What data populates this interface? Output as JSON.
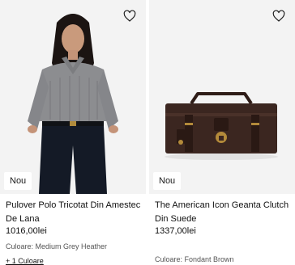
{
  "products": [
    {
      "badge": "Nou",
      "title": "Pulover Polo Tricotat Din Amestec De Lana",
      "price": "1016,00lei",
      "color": "Culoare: Medium Grey Heather",
      "more_colors": "+ 1 Culoare",
      "icons": {
        "wishlist": "heart-outline-icon"
      }
    },
    {
      "badge": "Nou",
      "title": "The American Icon Geanta Clutch Din Suede",
      "price": "1337,00lei",
      "color": "Culoare: Fondant Brown",
      "icons": {
        "wishlist": "heart-outline-icon"
      }
    }
  ],
  "colors": {
    "image_bg": "#f1f1f1",
    "suede_brown": "#3b2620",
    "sweater_grey": "#8c8d90"
  }
}
